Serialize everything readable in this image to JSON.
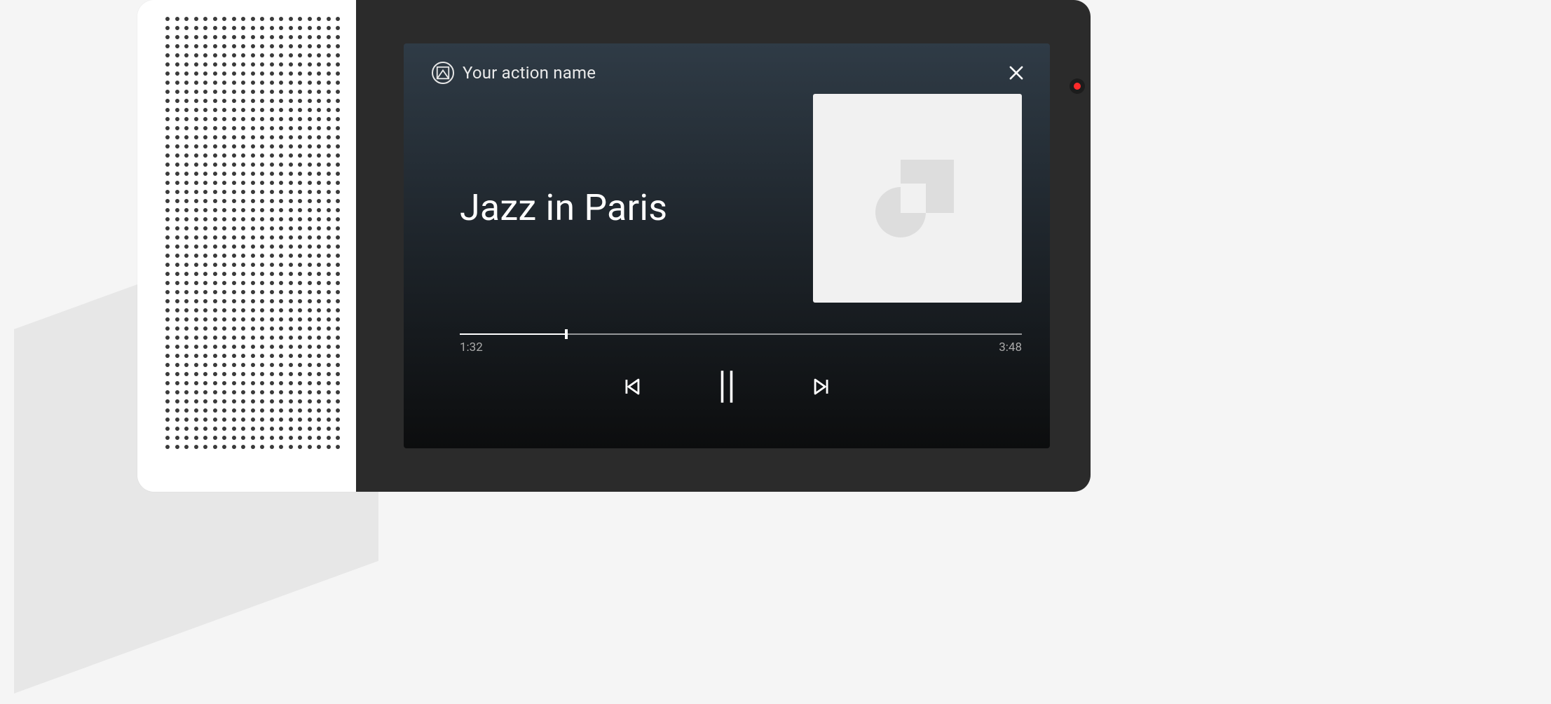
{
  "header": {
    "action_name": "Your action name",
    "close_label": "Close"
  },
  "track": {
    "title": "Jazz in Paris",
    "elapsed": "1:32",
    "duration": "3:48",
    "progress_percent": 19
  },
  "controls": {
    "previous_label": "Previous track",
    "play_pause_label": "Pause",
    "next_label": "Next track"
  },
  "icons": {
    "logo": "logo-geometric-icon",
    "close": "close-icon",
    "previous": "skip-previous-icon",
    "play_pause": "pause-icon",
    "next": "skip-next-icon",
    "album_placeholder": "album-placeholder-icon",
    "led": "recording-led-icon"
  },
  "colors": {
    "card_gradient_top": "#2f3b46",
    "card_gradient_bottom": "#0c0d0e",
    "device_bezel": "#2b2b2b",
    "led": "#ff2a2a"
  }
}
